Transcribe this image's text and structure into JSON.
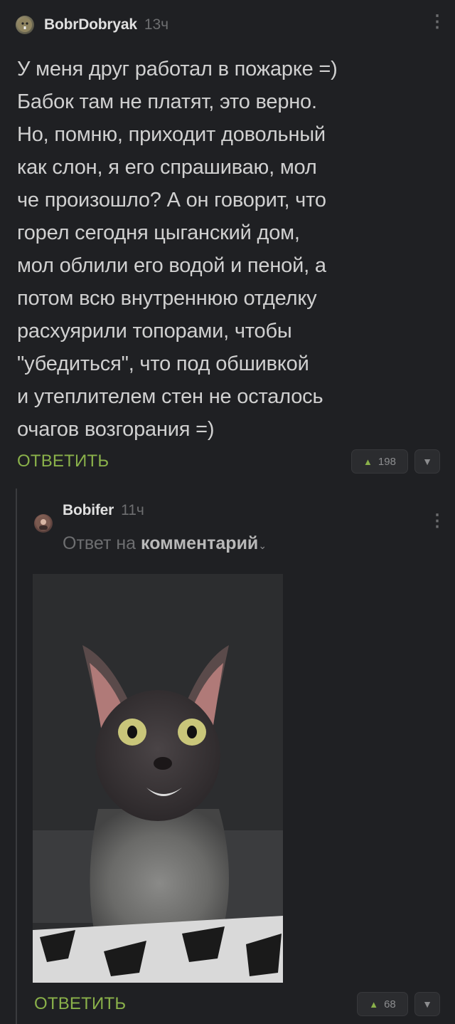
{
  "comment1": {
    "author": "BobrDobryak",
    "time": "13ч",
    "text": "У меня друг работал в пожарке =)\nБабок там не платят, это верно.\nНо, помню, приходит довольный\nкак слон, я его спрашиваю, мол\nче произошло? А он говорит, что\nгорел сегодня цыганский дом,\nмол облили его водой и пеной, а\nпотом всю внутреннюю отделку\nрасхуярили топорами, чтобы\n\"убедиться\", что под обшивкой\nи утеплителем стен не осталось\nочагов возгорания =)",
    "reply_label": "ОТВЕТИТЬ",
    "rating": "198"
  },
  "comment2": {
    "author": "Bobifer",
    "time": "11ч",
    "reply_prefix": "Ответ на",
    "reply_target": "комментарий",
    "reply_label": "ОТВЕТИТЬ",
    "rating": "68"
  },
  "icons": {
    "more": "more-vertical-icon",
    "upvote": "arrow-up-icon",
    "downvote": "arrow-down-icon",
    "chevron": "chevron-down-icon"
  },
  "colors": {
    "background": "#1f2023",
    "accent_green": "#8ab14a",
    "muted": "#6d6e70"
  }
}
